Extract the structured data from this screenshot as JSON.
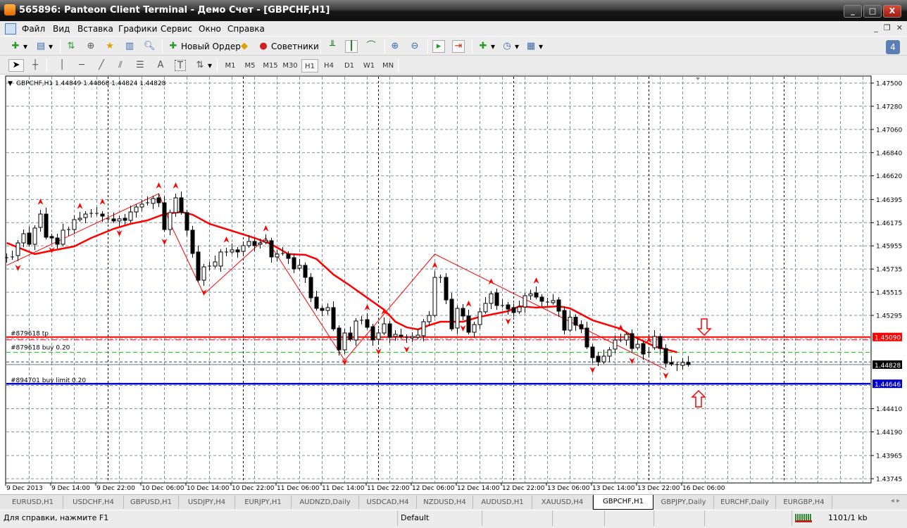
{
  "window": {
    "title": "565896: Panteon Client Terminal - Демо Счет - [GBPCHF,H1]"
  },
  "menu": [
    "Файл",
    "Вид",
    "Вставка",
    "Графики",
    "Сервис",
    "Окно",
    "Справка"
  ],
  "toolbar": {
    "new_order": "Новый Ордер",
    "experts": "Советники",
    "messages_count": "4"
  },
  "drawing_tools": {
    "text_tool": "A",
    "label_tool": "T"
  },
  "timeframes": {
    "items": [
      "M1",
      "M5",
      "M15",
      "M30",
      "H1",
      "H4",
      "D1",
      "W1",
      "MN"
    ],
    "active": "H1"
  },
  "chart": {
    "header": "GBPCHF,H1  1.44849 1.44868 1.44824 1.44828",
    "symbol": "GBPCHF",
    "timeframe": "H1",
    "ohlc": {
      "open": 1.44849,
      "high": 1.44868,
      "low": 1.44824,
      "close": 1.44828
    },
    "price_axis": [
      "1.47500",
      "1.47280",
      "1.47060",
      "1.46840",
      "1.46620",
      "1.46395",
      "1.46175",
      "1.45955",
      "1.45735",
      "1.45515",
      "1.45295",
      "1.44410",
      "1.44190",
      "1.43965",
      "1.43745"
    ],
    "price_range": [
      1.43745,
      1.475
    ],
    "grid_prices": [
      1.475,
      1.4728,
      1.4706,
      1.4684,
      1.4662,
      1.46395,
      1.46175,
      1.45955,
      1.45735,
      1.45515,
      1.45295,
      1.45075,
      1.4485,
      1.4463,
      1.4441,
      1.4419,
      1.43965,
      1.43745
    ],
    "time_axis": [
      "9 Dec 2013",
      "9 Dec 14:00",
      "9 Dec 22:00",
      "10 Dec 06:00",
      "10 Dec 14:00",
      "10 Dec 22:00",
      "11 Dec 06:00",
      "11 Dec 14:00",
      "11 Dec 22:00",
      "12 Dec 06:00",
      "12 Dec 14:00",
      "12 Dec 22:00",
      "13 Dec 06:00",
      "13 Dec 14:00",
      "13 Dec 22:00",
      "16 Dec 06:00"
    ],
    "colors": {
      "bull_body": "#ffffff",
      "bear_body": "#000000",
      "ma": "#ff0000",
      "zigzag": "#ff0000",
      "tp": "#ff0000",
      "order": "#00cc00",
      "limit": "#0000cc",
      "grid": "#8090a0"
    },
    "candles_open_close": [
      [
        1.45836,
        1.45843
      ],
      [
        1.45843,
        1.4585
      ],
      [
        1.45863,
        1.45983
      ],
      [
        1.45983,
        1.4607
      ],
      [
        1.46077,
        1.4597
      ],
      [
        1.4597,
        1.46124
      ],
      [
        1.4613,
        1.46257
      ],
      [
        1.46257,
        1.46037
      ],
      [
        1.46044,
        1.4603
      ],
      [
        1.4603,
        1.4597
      ],
      [
        1.4597,
        1.46104
      ],
      [
        1.46104,
        1.4611
      ],
      [
        1.4611,
        1.46204
      ],
      [
        1.46204,
        1.46217
      ],
      [
        1.46224,
        1.46257
      ],
      [
        1.46264,
        1.46264
      ],
      [
        1.46264,
        1.46264
      ],
      [
        1.46257,
        1.46237
      ],
      [
        1.46211,
        1.46211
      ],
      [
        1.46211,
        1.46191
      ],
      [
        1.46191,
        1.46211
      ],
      [
        1.46217,
        1.46197
      ],
      [
        1.46197,
        1.46277
      ],
      [
        1.46277,
        1.46324
      ],
      [
        1.46324,
        1.46351
      ],
      [
        1.46358,
        1.46364
      ],
      [
        1.46358,
        1.46404
      ],
      [
        1.46411,
        1.46364
      ],
      [
        1.46364,
        1.4611
      ],
      [
        1.4611,
        1.46271
      ],
      [
        1.46271,
        1.46411
      ],
      [
        1.46411,
        1.46271
      ],
      [
        1.46271,
        1.46104
      ],
      [
        1.46104,
        1.45883
      ],
      [
        1.45897,
        1.45629
      ],
      [
        1.45629,
        1.45756
      ],
      [
        1.45763,
        1.45763
      ],
      [
        1.45763,
        1.45803
      ],
      [
        1.45763,
        1.45897
      ],
      [
        1.45897,
        1.45897
      ],
      [
        1.45897,
        1.45917
      ],
      [
        1.45917,
        1.45897
      ],
      [
        1.45903,
        1.45957
      ],
      [
        1.45957,
        1.45997
      ],
      [
        1.45997,
        1.45957
      ],
      [
        1.4597,
        1.45983
      ],
      [
        1.4599,
        1.46004
      ],
      [
        1.46004,
        1.4585
      ],
      [
        1.4585,
        1.45877
      ],
      [
        1.45883,
        1.45883
      ],
      [
        1.45877,
        1.45836
      ],
      [
        1.45843,
        1.45736
      ],
      [
        1.45743,
        1.4577
      ],
      [
        1.4577,
        1.45656
      ],
      [
        1.45656,
        1.45462
      ],
      [
        1.45469,
        1.45362
      ],
      [
        1.45362,
        1.45342
      ],
      [
        1.45342,
        1.45369
      ],
      [
        1.45369,
        1.45167
      ],
      [
        1.45175,
        1.44968
      ],
      [
        1.44968,
        1.45128
      ],
      [
        1.45128,
        1.45068
      ],
      [
        1.45061,
        1.45242
      ],
      [
        1.45249,
        1.45249
      ],
      [
        1.45255,
        1.45182
      ],
      [
        1.45188,
        1.45061
      ],
      [
        1.45068,
        1.45128
      ],
      [
        1.45128,
        1.45215
      ],
      [
        1.45215,
        1.45088
      ],
      [
        1.45095,
        1.45115
      ],
      [
        1.45108,
        1.45095
      ],
      [
        1.45088,
        1.45088
      ],
      [
        1.45082,
        1.45095
      ],
      [
        1.45088,
        1.45108
      ],
      [
        1.45102,
        1.45235
      ],
      [
        1.45235,
        1.45295
      ],
      [
        1.45295,
        1.45656
      ],
      [
        1.45656,
        1.45656
      ],
      [
        1.45656,
        1.45442
      ],
      [
        1.45449,
        1.45167
      ],
      [
        1.45175,
        1.45362
      ],
      [
        1.45362,
        1.45289
      ],
      [
        1.45289,
        1.45135
      ],
      [
        1.45135,
        1.45208
      ],
      [
        1.45208,
        1.45329
      ],
      [
        1.45329,
        1.45409
      ],
      [
        1.45409,
        1.455
      ],
      [
        1.45509,
        1.45389
      ],
      [
        1.45389,
        1.45389
      ],
      [
        1.45395,
        1.45355
      ],
      [
        1.45369,
        1.45322
      ],
      [
        1.45329,
        1.45375
      ],
      [
        1.45375,
        1.45482
      ],
      [
        1.45482,
        1.455
      ],
      [
        1.45509,
        1.45469
      ],
      [
        1.45469,
        1.45429
      ],
      [
        1.45422,
        1.45422
      ],
      [
        1.45416,
        1.45436
      ],
      [
        1.45442,
        1.45335
      ],
      [
        1.45342,
        1.45155
      ],
      [
        1.45155,
        1.45278
      ],
      [
        1.45278,
        1.45202
      ],
      [
        1.45208,
        1.45167
      ],
      [
        1.45175,
        1.44995
      ],
      [
        1.44995,
        1.44894
      ],
      [
        1.44908,
        1.44854
      ],
      [
        1.44854,
        1.44908
      ],
      [
        1.44908,
        1.44968
      ],
      [
        1.44975,
        1.45061
      ],
      [
        1.45061,
        1.45061
      ],
      [
        1.45061,
        1.45115
      ],
      [
        1.45122,
        1.44981
      ],
      [
        1.44988,
        1.45021
      ],
      [
        1.45028,
        1.44928
      ],
      [
        1.44945,
        1.44945
      ],
      [
        1.44988,
        1.45095
      ],
      [
        1.45095,
        1.44981
      ],
      [
        1.44981,
        1.44841
      ],
      [
        1.44848,
        1.44834
      ],
      [
        1.44828,
        1.44821
      ],
      [
        1.44821,
        1.44848
      ],
      [
        1.44849,
        1.44828
      ]
    ],
    "moving_average": [
      [
        0,
        1.45983
      ],
      [
        5,
        1.45877
      ],
      [
        8,
        1.4591
      ],
      [
        12,
        1.4595
      ],
      [
        15,
        1.4603
      ],
      [
        19,
        1.46117
      ],
      [
        22,
        1.46164
      ],
      [
        25,
        1.46197
      ],
      [
        28,
        1.46257
      ],
      [
        31,
        1.46277
      ],
      [
        33,
        1.46251
      ],
      [
        36,
        1.46164
      ],
      [
        40,
        1.46097
      ],
      [
        44,
        1.4603
      ],
      [
        47,
        1.4597
      ],
      [
        50,
        1.45877
      ],
      [
        53,
        1.4587
      ],
      [
        55,
        1.4583
      ],
      [
        58,
        1.45683
      ],
      [
        61,
        1.45576
      ],
      [
        64,
        1.45462
      ],
      [
        67,
        1.45349
      ],
      [
        69,
        1.45235
      ],
      [
        71,
        1.45182
      ],
      [
        73,
        1.45162
      ],
      [
        75,
        1.45202
      ],
      [
        77,
        1.45235
      ],
      [
        81,
        1.45235
      ],
      [
        84,
        1.45282
      ],
      [
        89,
        1.45335
      ],
      [
        91,
        1.45382
      ],
      [
        94,
        1.45369
      ],
      [
        98,
        1.45382
      ],
      [
        100,
        1.45362
      ],
      [
        104,
        1.45249
      ],
      [
        109,
        1.45167
      ],
      [
        111,
        1.45102
      ],
      [
        115,
        1.45001
      ],
      [
        119,
        1.44945
      ]
    ],
    "zigzag": [
      [
        0,
        1.4577
      ],
      [
        27,
        1.46451
      ],
      [
        29,
        1.4617
      ],
      [
        35,
        1.45496
      ],
      [
        46,
        1.4603
      ],
      [
        60,
        1.44868
      ],
      [
        76,
        1.45877
      ],
      [
        117,
        1.44781
      ]
    ],
    "fractals_up": [
      6,
      13,
      17,
      27,
      30,
      39,
      46,
      64,
      67,
      76,
      82,
      86,
      94,
      109,
      114
    ],
    "fractals_down": [
      2,
      8,
      20,
      28,
      35,
      60,
      66,
      71,
      81,
      89,
      104,
      111,
      117
    ],
    "levels": [
      {
        "label": "#879618 tp",
        "price": 1.4509,
        "price_label": "1.45090",
        "color": "#ff0000"
      },
      {
        "label": "#879618 buy 0.20",
        "price": 1.44945,
        "color": "#00cc00"
      },
      {
        "label": "",
        "price": 1.44828,
        "price_label": "1.44828",
        "color": "#000000"
      },
      {
        "label": "#894701 buy limit 0.20",
        "price": 1.44646,
        "price_label": "1.44646",
        "color": "#0000cc"
      }
    ]
  },
  "tabs": {
    "items": [
      "EURUSD,H1",
      "USDCHF,H4",
      "GBPUSD,H1",
      "USDJPY,H4",
      "EURJPY,H1",
      "AUDNZD,Daily",
      "USDCAD,H4",
      "NZDUSD,H4",
      "AUDUSD,H1",
      "XAUUSD,H4",
      "GBPCHF,H1",
      "GBPJPY,Daily",
      "EURCHF,Daily",
      "EURGBP,H4"
    ],
    "active": "GBPCHF,H1"
  },
  "status": {
    "help": "Для справки, нажмите F1",
    "profile": "Default",
    "traffic": "1101/1 kb"
  }
}
